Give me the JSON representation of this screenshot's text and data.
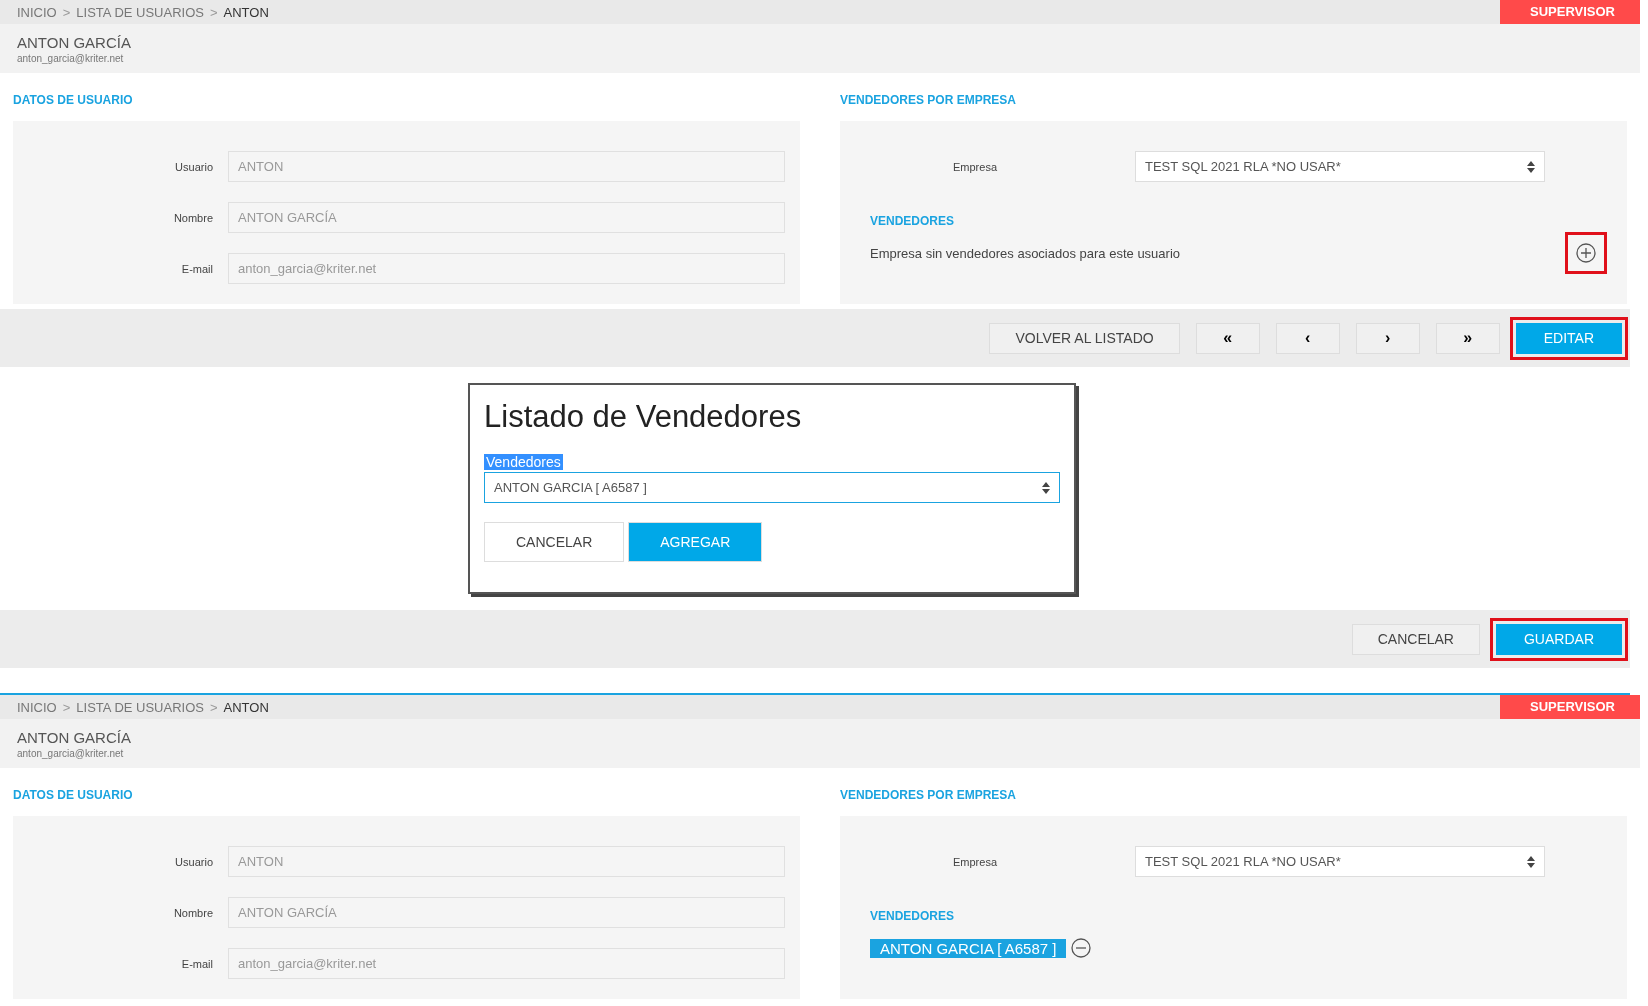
{
  "view_before": {
    "breadcrumb": [
      {
        "label": "INICIO",
        "current": false
      },
      {
        "label": "LISTA DE USUARIOS",
        "current": false
      },
      {
        "label": "ANTON",
        "current": true
      }
    ],
    "separator": ">",
    "role_badge": "SUPERVISOR",
    "user_name": "ANTON GARCÍA",
    "user_email": "anton_garcia@kriter.net",
    "user_section": {
      "title": "DATOS DE USUARIO",
      "fields": [
        {
          "label": "Usuario",
          "value": "ANTON"
        },
        {
          "label": "Nombre",
          "value": "ANTON GARCÍA"
        },
        {
          "label": "E-mail",
          "value": "anton_garcia@kriter.net"
        }
      ]
    },
    "company_section": {
      "title": "VENDEDORES POR EMPRESA",
      "company_label": "Empresa",
      "company_value": "TEST SQL 2021 RLA *NO USAR*",
      "vendors_title": "VENDEDORES",
      "empty_message": "Empresa sin vendedores asociados para este usuario",
      "add_icon": {
        "highlighted": true
      }
    },
    "toolbar": [
      {
        "kind": "text",
        "label": "VOLVER AL LISTADO",
        "highlighted": false
      },
      {
        "kind": "nav",
        "label": "«",
        "highlighted": false
      },
      {
        "kind": "nav",
        "label": "‹",
        "highlighted": false
      },
      {
        "kind": "nav",
        "label": "›",
        "highlighted": false
      },
      {
        "kind": "nav",
        "label": "»",
        "highlighted": false
      },
      {
        "kind": "primary",
        "label": "EDITAR",
        "highlighted": true
      }
    ]
  },
  "modal": {
    "title": "Listado de Vendedores",
    "field_label": "Vendedores",
    "field_label_selected": true,
    "field_value": "ANTON GARCIA [ A6587 ]",
    "buttons": [
      {
        "kind": "text",
        "label": "CANCELAR"
      },
      {
        "kind": "primary",
        "label": "AGREGAR"
      }
    ]
  },
  "edit_toolbar": [
    {
      "kind": "text",
      "label": "CANCELAR",
      "highlighted": false
    },
    {
      "kind": "primary",
      "label": "GUARDAR",
      "highlighted": true
    }
  ],
  "view_after": {
    "breadcrumb": [
      {
        "label": "INICIO",
        "current": false
      },
      {
        "label": "LISTA DE USUARIOS",
        "current": false
      },
      {
        "label": "ANTON",
        "current": true
      }
    ],
    "separator": ">",
    "role_badge": "SUPERVISOR",
    "user_name": "ANTON GARCÍA",
    "user_email": "anton_garcia@kriter.net",
    "user_section": {
      "title": "DATOS DE USUARIO",
      "fields": [
        {
          "label": "Usuario",
          "value": "ANTON"
        },
        {
          "label": "Nombre",
          "value": "ANTON GARCÍA"
        },
        {
          "label": "E-mail",
          "value": "anton_garcia@kriter.net"
        }
      ]
    },
    "company_section": {
      "title": "VENDEDORES POR EMPRESA",
      "company_label": "Empresa",
      "company_value": "TEST SQL 2021 RLA *NO USAR*",
      "vendors_title": "VENDEDORES",
      "vendors": [
        {
          "label": "ANTON GARCIA [ A6587 ]"
        }
      ]
    }
  }
}
